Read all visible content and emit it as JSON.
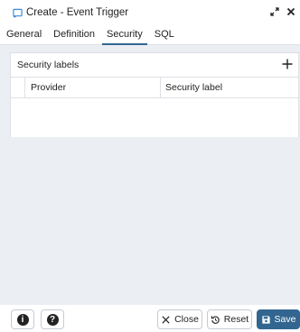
{
  "dialog": {
    "title": "Create - Event Trigger"
  },
  "tabs": [
    {
      "label": "General"
    },
    {
      "label": "Definition"
    },
    {
      "label": "Security"
    },
    {
      "label": "SQL"
    }
  ],
  "active_tab": "Security",
  "security_labels": {
    "heading": "Security labels",
    "columns": [
      "Provider",
      "Security label"
    ],
    "rows": []
  },
  "footer": {
    "info_icon": "info-icon",
    "help_icon": "question-icon",
    "close_label": "Close",
    "reset_label": "Reset",
    "save_label": "Save"
  },
  "colors": {
    "accent": "#326690",
    "content_bg": "#ebeef3"
  }
}
